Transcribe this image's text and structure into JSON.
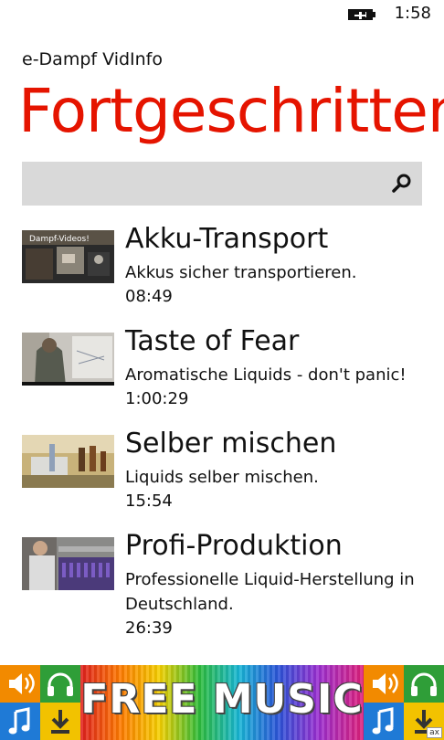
{
  "status": {
    "time": "1:58",
    "battery_icon": "battery-charging-icon"
  },
  "app": {
    "name": "e-Dampf VidInfo",
    "page_title": "Fortgeschritten"
  },
  "search": {
    "placeholder": "",
    "value": "",
    "icon": "search-icon"
  },
  "videos": [
    {
      "title": "Akku-Transport",
      "description": "Akkus sicher transportieren.",
      "duration": "08:49",
      "thumb_text": "Dampf-Videos!"
    },
    {
      "title": "Taste of Fear",
      "description": "Aromatische Liquids - don't panic!",
      "duration": "1:00:29"
    },
    {
      "title": "Selber mischen",
      "description": "Liquids selber mischen.",
      "duration": "15:54"
    },
    {
      "title": "Profi-Produktion",
      "description": "Professionelle Liquid-Herstellung in Deutschland.",
      "duration": "26:39"
    }
  ],
  "ad": {
    "text": "FREE MUSIC",
    "badge": "ax"
  },
  "colors": {
    "accent": "#e51400",
    "search_bg": "#d9d9d9"
  }
}
